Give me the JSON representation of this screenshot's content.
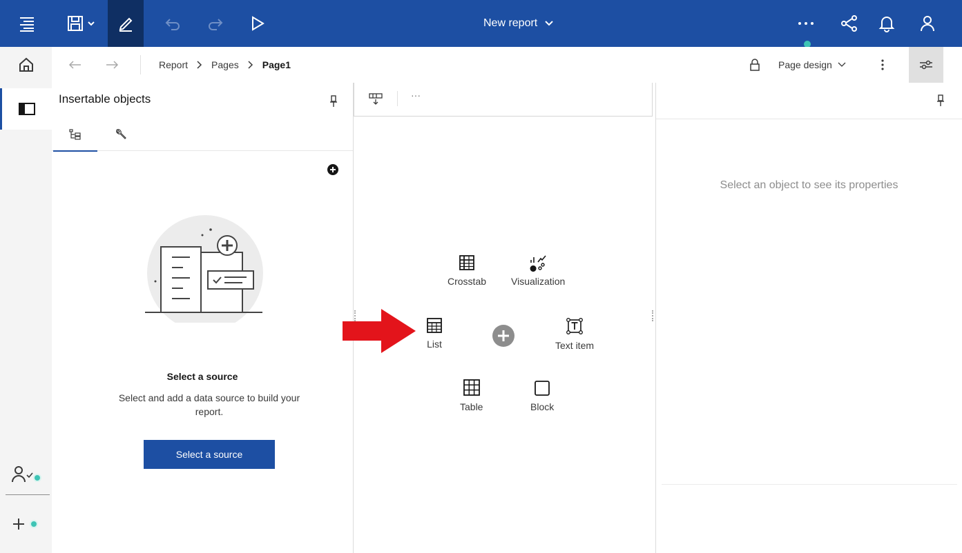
{
  "topbar": {
    "report_title": "New report",
    "colors": {
      "bar": "#1d4fa3",
      "active": "#0f2f63"
    },
    "icons": [
      "menu-icon",
      "save-icon",
      "edit-icon",
      "undo-icon",
      "redo-icon",
      "run-icon",
      "more-icon",
      "share-icon",
      "notification-icon",
      "user-icon"
    ]
  },
  "breadcrumb": {
    "items": [
      "Report",
      "Pages",
      "Page1"
    ]
  },
  "view_selector": {
    "label": "Page design"
  },
  "left_panel": {
    "title": "Insertable objects",
    "empty_state": {
      "title": "Select a source",
      "description": "Select and add a data source to build your report.",
      "button": "Select a source"
    }
  },
  "canvas": {
    "toolbar_more": "···",
    "insert_items": {
      "crosstab": "Crosstab",
      "visualization": "Visualization",
      "list": "List",
      "text_item": "Text item",
      "table": "Table",
      "block": "Block"
    }
  },
  "properties_panel": {
    "message": "Select an object to see its properties"
  },
  "annotation": {
    "arrow_color": "#e3141b"
  }
}
